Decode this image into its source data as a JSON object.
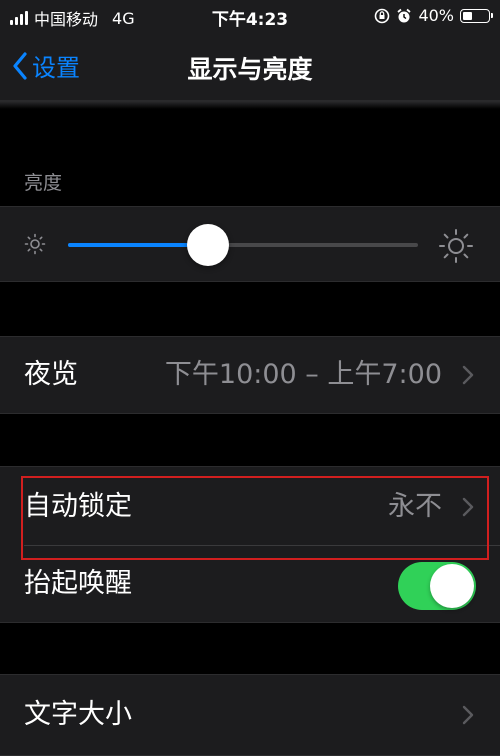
{
  "status_bar": {
    "carrier": "中国移动",
    "network": "4G",
    "time": "下午4:23",
    "battery_percent": "40%",
    "battery_level": 0.4
  },
  "nav": {
    "back_label": "设置",
    "title": "显示与亮度"
  },
  "brightness": {
    "section_title": "亮度",
    "level": 0.4
  },
  "night_shift": {
    "label": "夜览",
    "value": "下午10:00 – 上午7:00"
  },
  "auto_lock": {
    "label": "自动锁定",
    "value": "永不"
  },
  "raise_to_wake": {
    "label": "抬起唤醒",
    "enabled": true
  },
  "text_size": {
    "label": "文字大小"
  },
  "colors": {
    "accent": "#0a84ff",
    "toggle_on": "#30d158",
    "highlight": "#d11f1f"
  }
}
